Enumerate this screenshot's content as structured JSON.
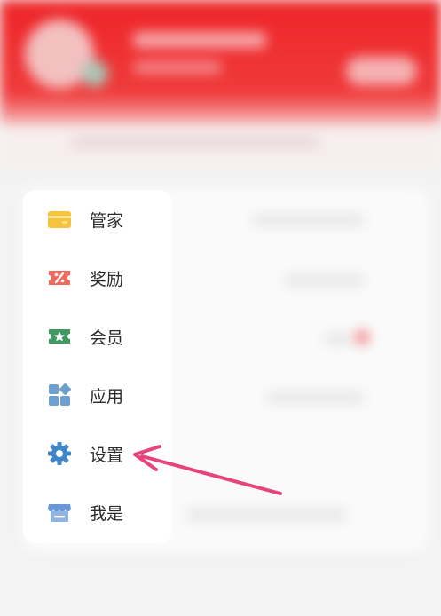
{
  "menu": {
    "items": [
      {
        "label": "管家",
        "icon": "wallet-icon",
        "color": "#f7c23c"
      },
      {
        "label": "奖励",
        "icon": "coupon-icon",
        "color": "#ef6a5d"
      },
      {
        "label": "会员",
        "icon": "vip-ticket-icon",
        "color": "#3f9a62"
      },
      {
        "label": "应用",
        "icon": "apps-grid-icon",
        "color": "#6d9fcf"
      },
      {
        "label": "设置",
        "icon": "gear-icon",
        "color": "#3f86c9"
      },
      {
        "label": "我是",
        "icon": "storefront-icon",
        "color": "#6a98d6"
      }
    ]
  },
  "annotation": {
    "arrow_color": "#e7457a",
    "points_to": "设置"
  },
  "colors": {
    "header_red": "#ee2428",
    "background": "#f3f3f3"
  }
}
